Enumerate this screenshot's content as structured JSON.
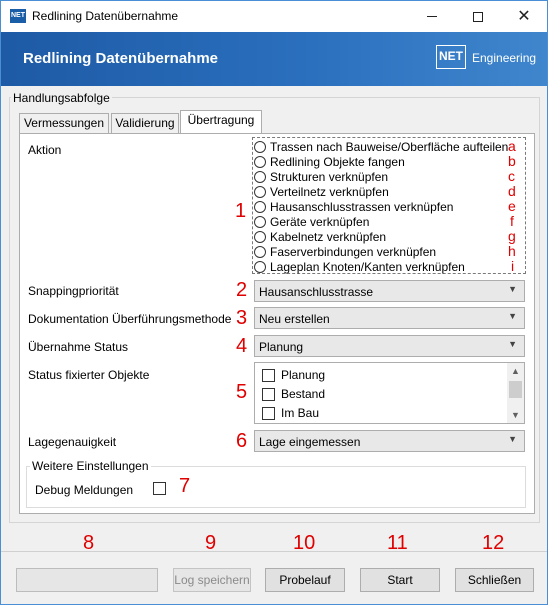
{
  "window": {
    "title": "Redlining Datenübernahme",
    "app_icon_text": "NET"
  },
  "banner": {
    "title": "Redlining Datenübernahme",
    "logo_box": "NET",
    "logo_text": "Engineering"
  },
  "group": {
    "legend": "Handlungsabfolge"
  },
  "tabs": [
    {
      "label": "Vermessungen",
      "active": false
    },
    {
      "label": "Validierung",
      "active": false
    },
    {
      "label": "Übertragung",
      "active": true
    }
  ],
  "form": {
    "aktion_label": "Aktion",
    "aktion_options": [
      "Trassen nach Bauweise/Oberfläche aufteilen",
      "Redlining Objekte fangen",
      "Strukturen verknüpfen",
      "Verteilnetz verknüpfen",
      "Hausanschlusstrassen verknüpfen",
      "Geräte verknüpfen",
      "Kabelnetz verknüpfen",
      "Faserverbindungen verknüpfen",
      "Lageplan Knoten/Kanten verknüpfen"
    ],
    "snapping_label": "Snappingpriorität",
    "snapping_value": "Hausanschlusstrasse",
    "doku_label": "Dokumentation Überführungsmethode",
    "doku_value": "Neu erstellen",
    "status_label": "Übernahme Status",
    "status_value": "Planung",
    "fixiert_label": "Status fixierter Objekte",
    "fixiert_options": [
      "Planung",
      "Bestand",
      "Im Bau"
    ],
    "lage_label": "Lagegenauigkeit",
    "lage_value": "Lage eingemessen",
    "weitere_legend": "Weitere Einstellungen",
    "debug_label": "Debug Meldungen"
  },
  "annotations": {
    "numbers": [
      "1",
      "2",
      "3",
      "4",
      "5",
      "6",
      "7",
      "8",
      "9",
      "10",
      "11",
      "12"
    ],
    "letters": [
      "a",
      "b",
      "c",
      "d",
      "e",
      "f",
      "g",
      "h",
      "i"
    ]
  },
  "buttons": {
    "log": "Log speichern",
    "probelauf": "Probelauf",
    "start": "Start",
    "schliessen": "Schließen"
  },
  "icons": {
    "minimize": "minimize-icon",
    "maximize": "maximize-icon",
    "close": "close-icon",
    "dropdown": "chevron-down-icon"
  },
  "colors": {
    "banner": "#2a6fbd",
    "annotation": "#e00000"
  }
}
